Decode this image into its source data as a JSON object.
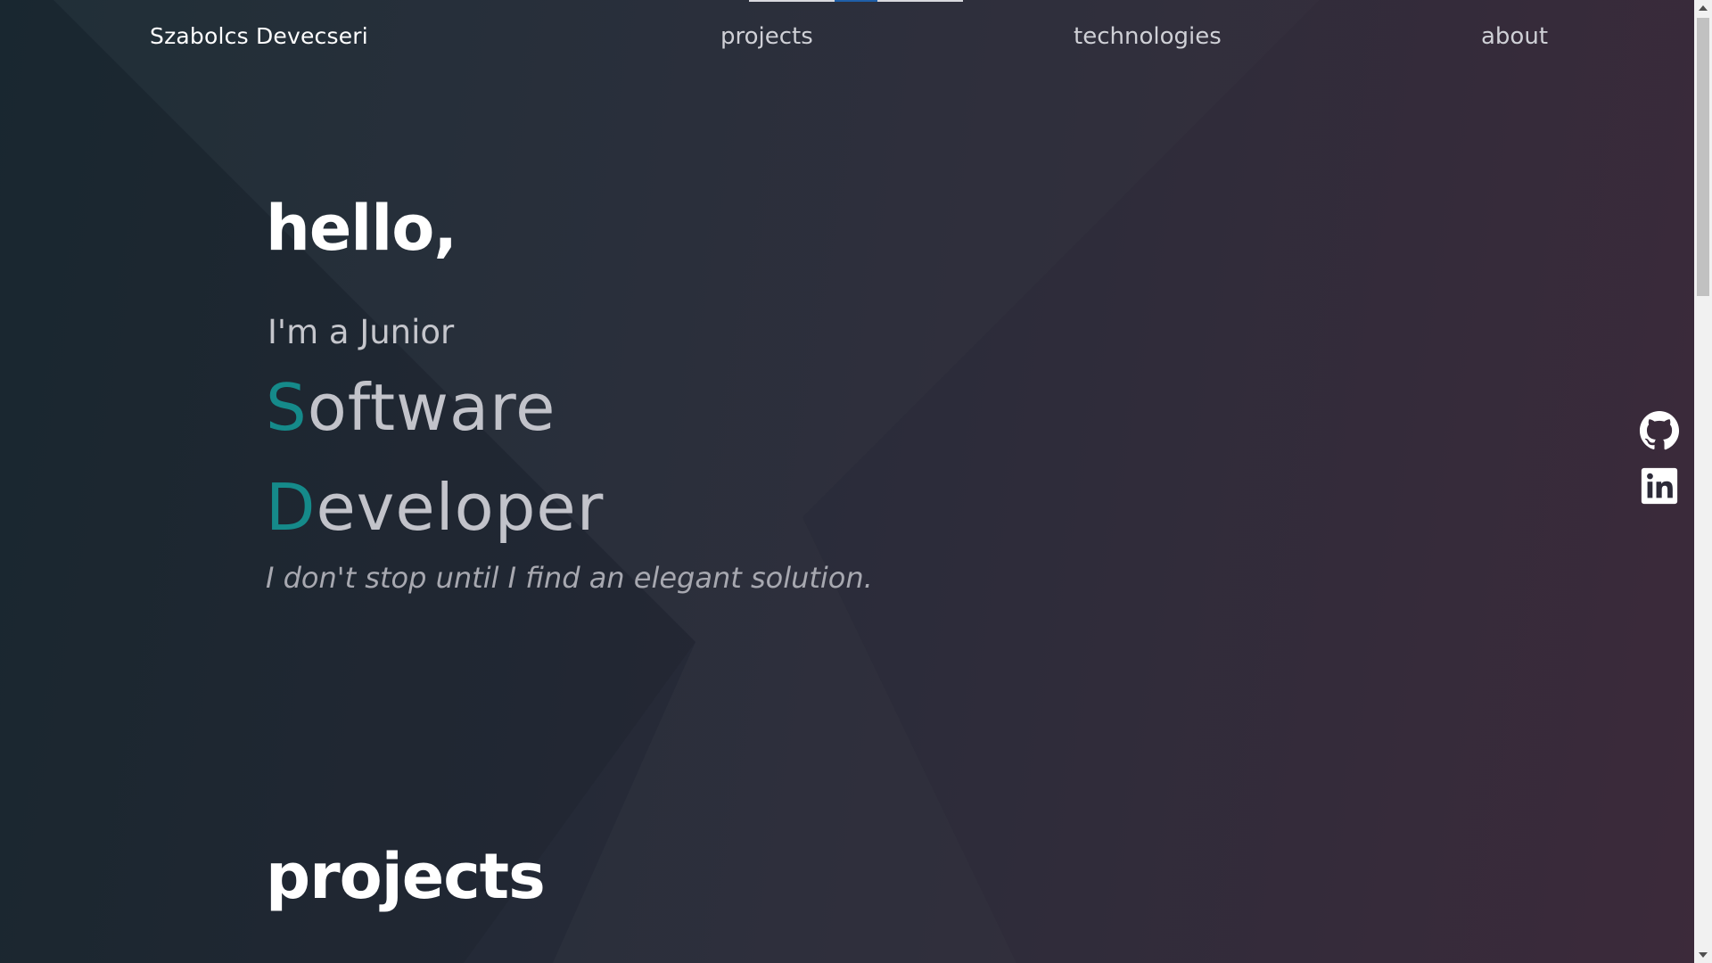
{
  "nav": {
    "brand": "Szabolcs Devecseri",
    "links": [
      {
        "label": "projects"
      },
      {
        "label": "technologies"
      },
      {
        "label": "about"
      }
    ]
  },
  "hero": {
    "greeting": "hello,",
    "intro": "I'm a Junior",
    "role_line_1": {
      "accent": "S",
      "rest": "oftware"
    },
    "role_line_2": {
      "accent": "D",
      "rest": "eveloper"
    },
    "tagline": "I don't stop until I find an elegant solution."
  },
  "sections": {
    "projects_title": "projects"
  },
  "social": [
    {
      "icon": "github-icon"
    },
    {
      "icon": "linkedin-icon"
    }
  ],
  "colors": {
    "accent": "#158a8a",
    "background_start": "#1b2a33",
    "background_end": "#3a2838",
    "text_primary": "#ffffff",
    "text_secondary": "#c2c3ca",
    "indicator": "#1f5fa8"
  }
}
